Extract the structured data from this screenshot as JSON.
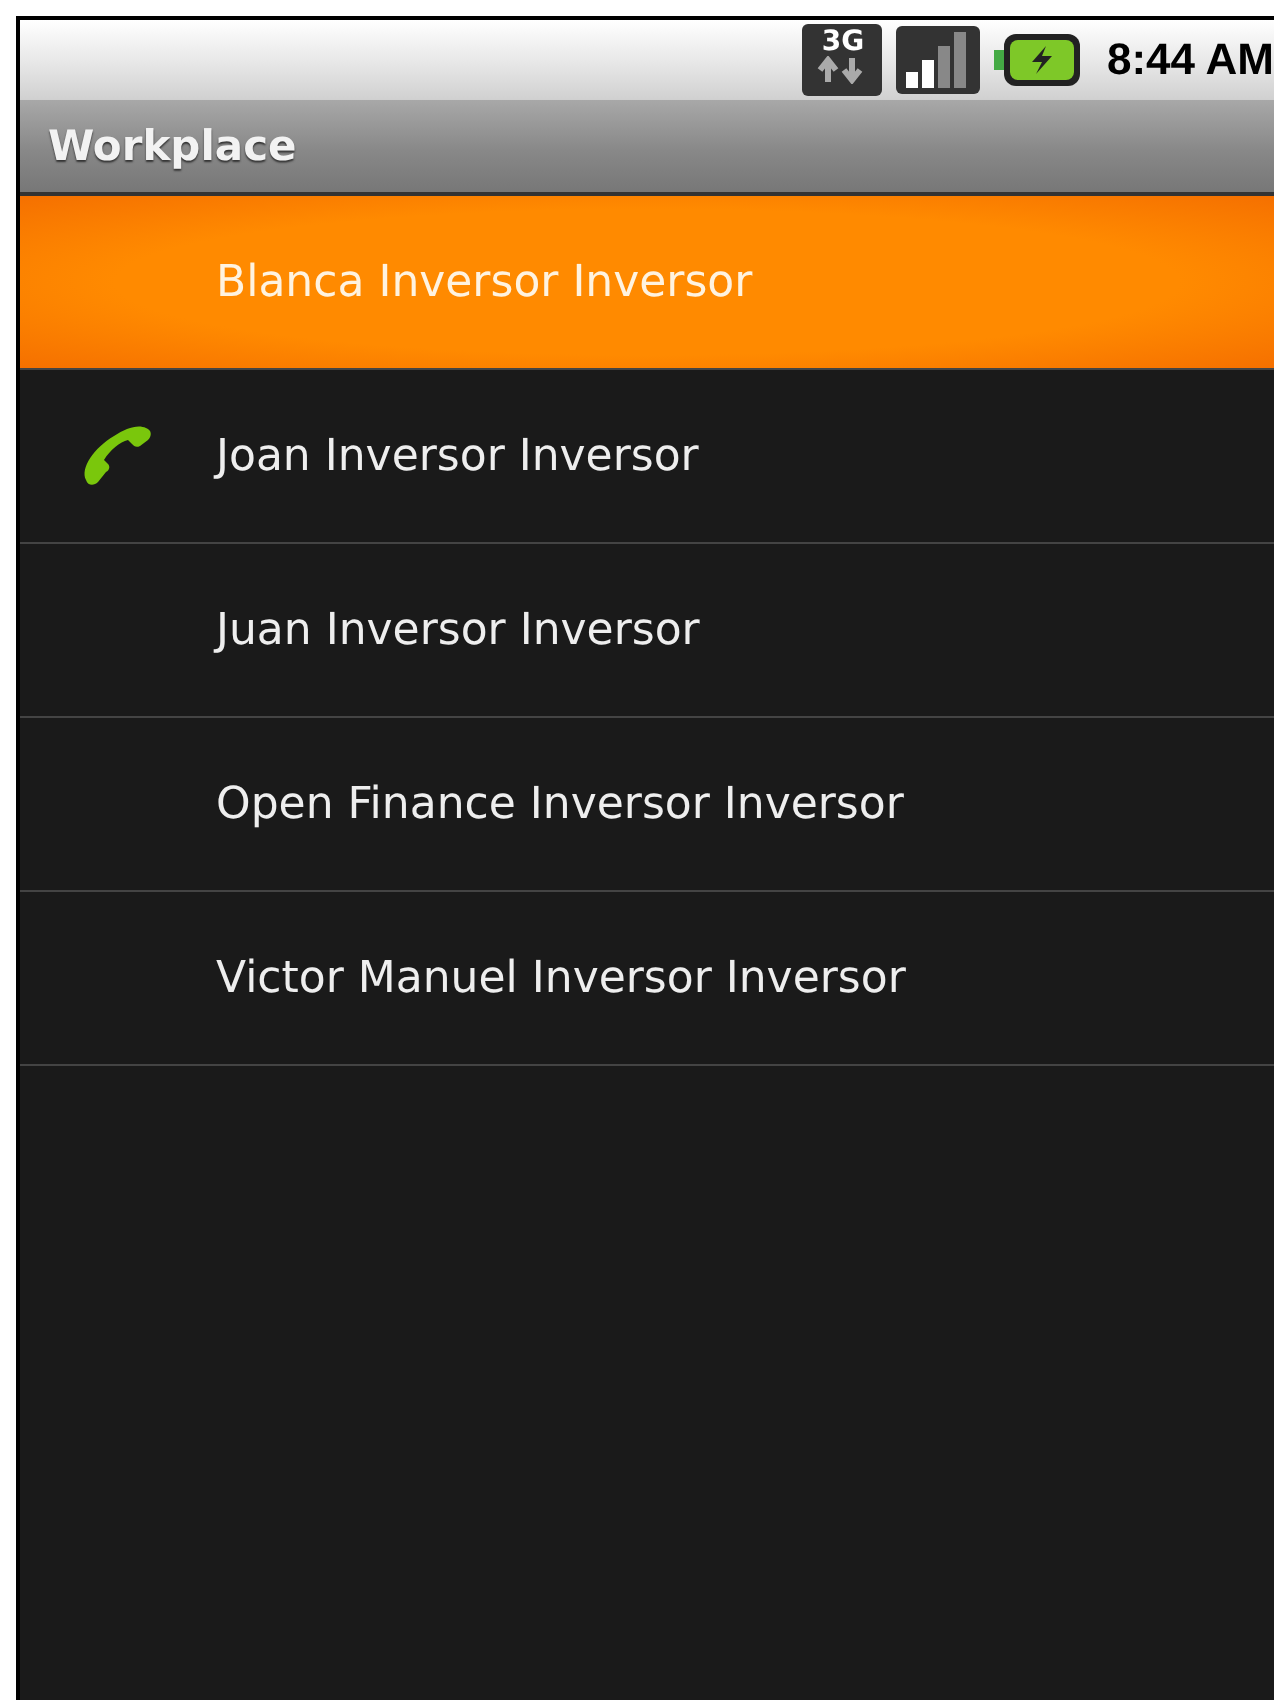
{
  "status_bar": {
    "network": "3G",
    "time": "8:44 AM"
  },
  "title": "Workplace",
  "contacts": [
    {
      "name": "Blanca Inversor Inversor",
      "selected": true,
      "calling": false
    },
    {
      "name": "Joan Inversor Inversor",
      "selected": false,
      "calling": true
    },
    {
      "name": "Juan Inversor Inversor",
      "selected": false,
      "calling": false
    },
    {
      "name": "Open Finance Inversor Inversor",
      "selected": false,
      "calling": false
    },
    {
      "name": "Victor Manuel Inversor Inversor",
      "selected": false,
      "calling": false
    }
  ]
}
